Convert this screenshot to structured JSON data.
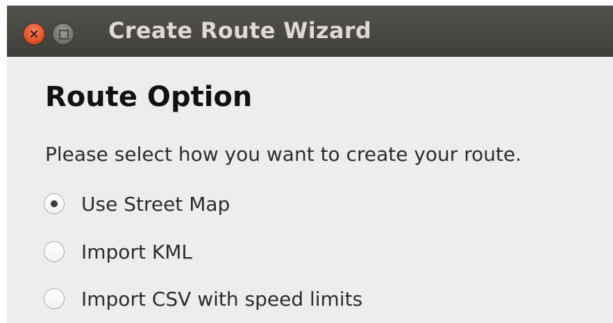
{
  "window": {
    "title": "Create Route Wizard"
  },
  "page": {
    "heading": "Route Option",
    "instruction": "Please select how you want to create your route."
  },
  "options": [
    {
      "label": "Use Street Map",
      "checked": true
    },
    {
      "label": "Import KML",
      "checked": false
    },
    {
      "label": "Import CSV with speed limits",
      "checked": false
    }
  ],
  "colors": {
    "titlebar": "#47463f",
    "close_button": "#e0542a",
    "background": "#efedeb"
  }
}
